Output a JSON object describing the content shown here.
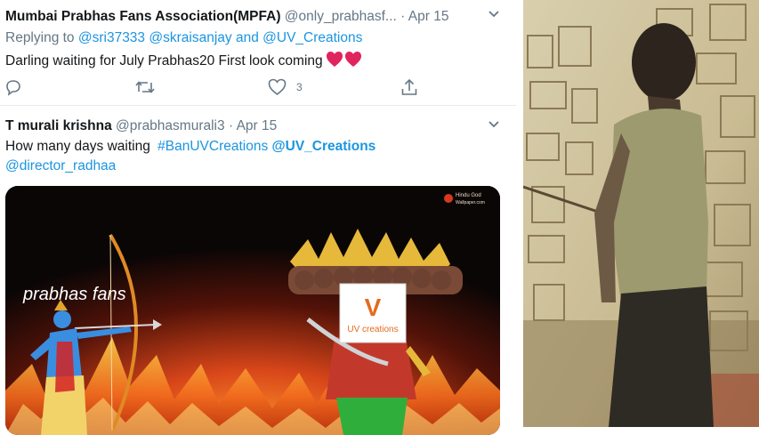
{
  "tweets": [
    {
      "name": "Mumbai Prabhas Fans Association(MPFA)",
      "handle": "@only_prabhasf...",
      "separator": "·",
      "date": "Apr 15",
      "reply_prefix": "Replying to",
      "reply_user1": "@sri37333",
      "reply_user2": "@skraisanjay",
      "reply_and": "and",
      "reply_user3": "@UV_Creations",
      "text": "Darling waiting for July Prabhas20 First look coming",
      "like_count": "3",
      "icons": [
        "reply-icon",
        "retweet-icon",
        "heart-icon",
        "share-icon",
        "chevron-down-icon"
      ]
    },
    {
      "name": "T murali krishna",
      "handle": "@prabhasmurali3",
      "separator": "·",
      "date": "Apr 15",
      "text": "How many days waiting",
      "hashtag": "#BanUVCreations",
      "mention1": "@UV_Creations",
      "mention2": "@director_radhaa",
      "image": {
        "caption_left": "prabhas fans",
        "logo_letter": "V",
        "logo_text": "UV creations",
        "watermark_line1": "Hindu God",
        "watermark_line2": "Wallpaper.com"
      }
    }
  ],
  "colors": {
    "link": "#1b95e0",
    "muted": "#657786",
    "heart": "#e0245e",
    "border": "#e6ecf0"
  }
}
